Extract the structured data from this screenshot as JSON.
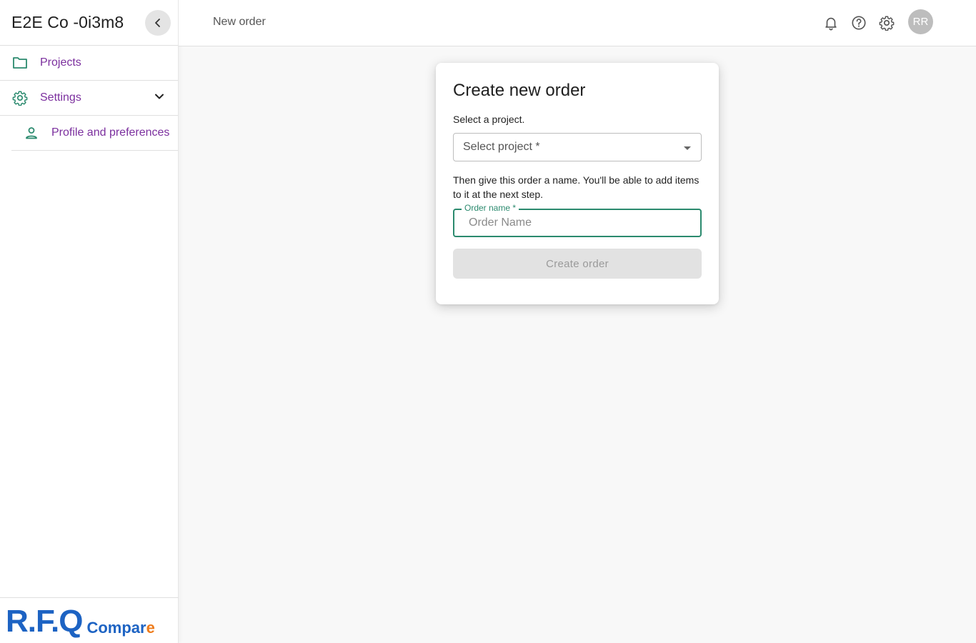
{
  "sidebar": {
    "org_name": "E2E Co -0i3m8",
    "items": [
      {
        "label": "Projects",
        "icon": "folder-icon"
      },
      {
        "label": "Settings",
        "icon": "gear-icon"
      }
    ],
    "subitems": [
      {
        "label": "Profile and preferences",
        "icon": "person-icon"
      }
    ],
    "logo": {
      "main": "R.F.Q",
      "sub_a": "Compar",
      "sub_b": "e"
    }
  },
  "topbar": {
    "title": "New order",
    "avatar_initials": "RR"
  },
  "card": {
    "title": "Create new order",
    "select_prompt": "Select a project.",
    "select_placeholder": "Select project *",
    "name_prompt": "Then give this order a name. You'll be able to add items to it at the next step.",
    "name_label": "Order name *",
    "name_placeholder": "Order Name",
    "name_value": "",
    "create_label": "Create order"
  },
  "colors": {
    "accent": "#2b8a6e",
    "nav_text": "#7b2f9e",
    "logo_blue": "#1d63c3",
    "logo_orange": "#ee7b1b"
  }
}
